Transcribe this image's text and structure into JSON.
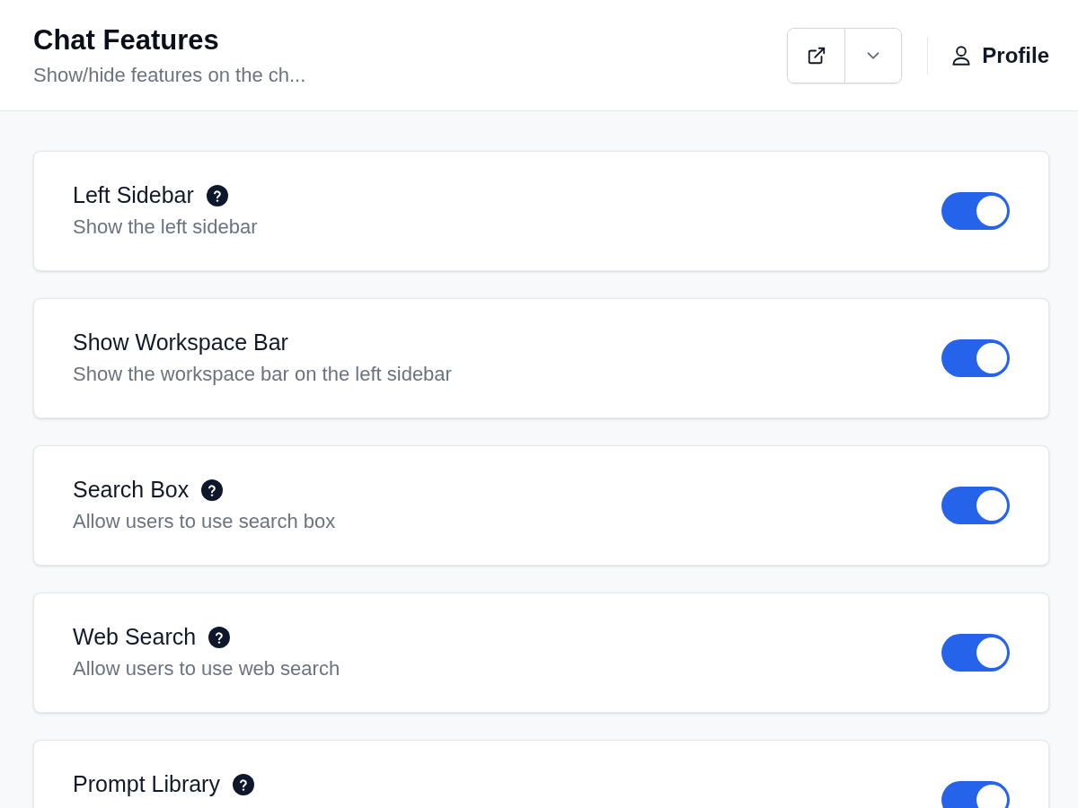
{
  "header": {
    "title": "Chat Features",
    "subtitle": "Show/hide features on the ch...",
    "profile": "Profile"
  },
  "features": [
    {
      "title": "Left Sidebar",
      "description": "Show the left sidebar",
      "help": true,
      "on": true
    },
    {
      "title": "Show Workspace Bar",
      "description": "Show the workspace bar on the left sidebar",
      "help": false,
      "on": true
    },
    {
      "title": "Search Box",
      "description": "Allow users to use search box",
      "help": true,
      "on": true
    },
    {
      "title": "Web Search",
      "description": "Allow users to use web search",
      "help": true,
      "on": true
    },
    {
      "title": "Prompt Library",
      "help": true,
      "on": true
    }
  ]
}
